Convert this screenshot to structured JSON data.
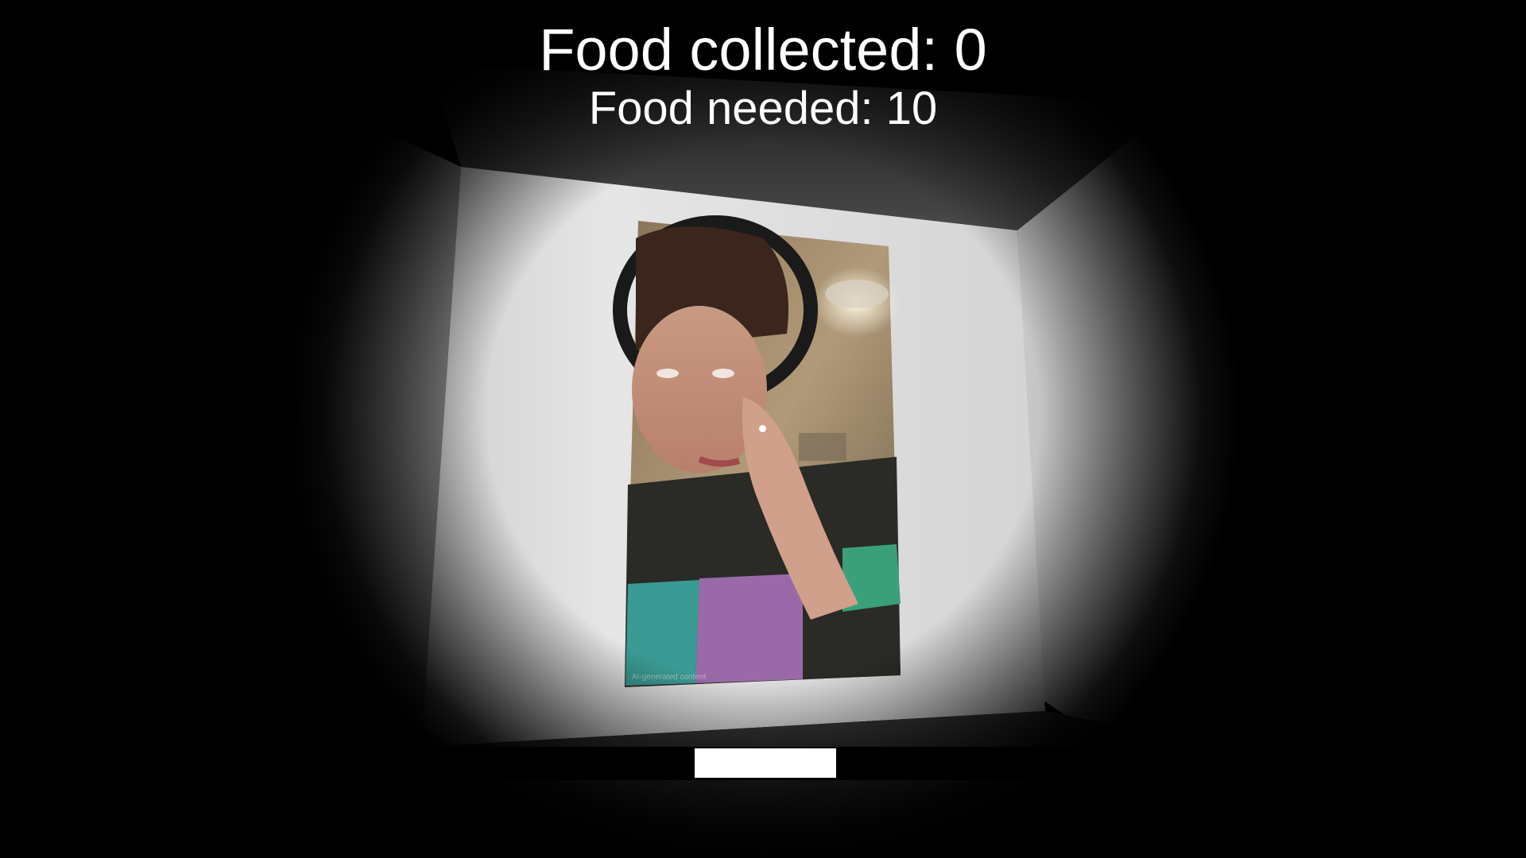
{
  "hud": {
    "food_collected": "Food collected: 0",
    "food_needed": "Food needed: 10",
    "food_collected_count": 0,
    "food_needed_count": 10
  },
  "poster": {
    "caption": "AI-generated content"
  },
  "colors": {
    "wall_back": "#d9d9d9",
    "wall_side": "#c8c8c8",
    "ceiling": "#3a3a3a",
    "floor": "#2c2c2c",
    "hud_text": "#ffffff",
    "hotbar": "#000000",
    "hotbar_slot": "#ffffff"
  },
  "icons": {
    "crosshair": "crosshair-dot"
  }
}
